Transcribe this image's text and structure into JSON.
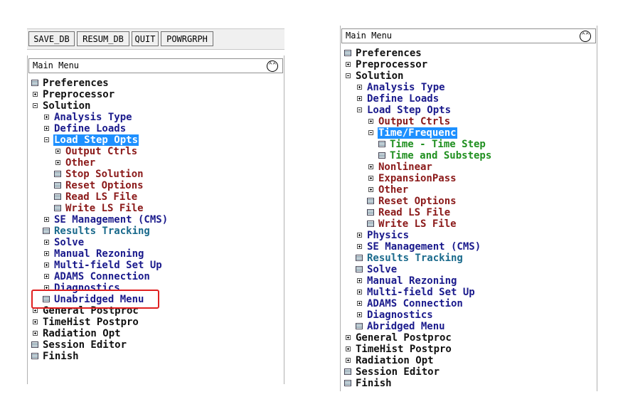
{
  "toolbar": {
    "buttons": [
      {
        "label": "SAVE_DB"
      },
      {
        "label": "RESUM_DB"
      },
      {
        "label": "QUIT"
      },
      {
        "label": "POWRGRPH"
      }
    ]
  },
  "left_panel": {
    "header_title": "Main Menu",
    "collapse_icon": "double-chevron-up-icon",
    "items": [
      {
        "label": "Preferences",
        "level": 0,
        "kind": "leaf",
        "color": "black"
      },
      {
        "label": "Preprocessor",
        "level": 0,
        "kind": "collapsed",
        "color": "black"
      },
      {
        "label": "Solution",
        "level": 0,
        "kind": "expanded",
        "color": "black"
      },
      {
        "label": "Analysis Type",
        "level": 1,
        "kind": "collapsed",
        "color": "navy"
      },
      {
        "label": "Define Loads",
        "level": 1,
        "kind": "collapsed",
        "color": "navy"
      },
      {
        "label": "Load Step Opts",
        "level": 1,
        "kind": "expanded",
        "color": "navy",
        "selected": true
      },
      {
        "label": "Output Ctrls",
        "level": 2,
        "kind": "collapsed",
        "color": "red"
      },
      {
        "label": "Other",
        "level": 2,
        "kind": "collapsed",
        "color": "red"
      },
      {
        "label": "Stop Solution",
        "level": 2,
        "kind": "leaf",
        "color": "red"
      },
      {
        "label": "Reset Options",
        "level": 2,
        "kind": "leaf",
        "color": "red"
      },
      {
        "label": "Read LS File",
        "level": 2,
        "kind": "leaf",
        "color": "red"
      },
      {
        "label": "Write LS File",
        "level": 2,
        "kind": "leaf",
        "color": "red"
      },
      {
        "label": "SE Management (CMS)",
        "level": 1,
        "kind": "collapsed",
        "color": "navy"
      },
      {
        "label": "Results Tracking",
        "level": 1,
        "kind": "leaf",
        "color": "teal"
      },
      {
        "label": "Solve",
        "level": 1,
        "kind": "collapsed",
        "color": "navy"
      },
      {
        "label": "Manual Rezoning",
        "level": 1,
        "kind": "collapsed",
        "color": "navy"
      },
      {
        "label": "Multi-field Set Up",
        "level": 1,
        "kind": "collapsed",
        "color": "navy"
      },
      {
        "label": "ADAMS Connection",
        "level": 1,
        "kind": "collapsed",
        "color": "navy"
      },
      {
        "label": "Diagnostics",
        "level": 1,
        "kind": "collapsed",
        "color": "navy"
      },
      {
        "label": "Unabridged Menu",
        "level": 1,
        "kind": "leaf",
        "color": "navy"
      },
      {
        "label": "General Postproc",
        "level": 0,
        "kind": "collapsed",
        "color": "black"
      },
      {
        "label": "TimeHist Postpro",
        "level": 0,
        "kind": "collapsed",
        "color": "black"
      },
      {
        "label": "Radiation Opt",
        "level": 0,
        "kind": "collapsed",
        "color": "black"
      },
      {
        "label": "Session Editor",
        "level": 0,
        "kind": "leaf",
        "color": "black"
      },
      {
        "label": "Finish",
        "level": 0,
        "kind": "leaf",
        "color": "black"
      }
    ]
  },
  "right_panel": {
    "header_title": "Main Menu",
    "collapse_icon": "double-chevron-up-icon",
    "items": [
      {
        "label": "Preferences",
        "level": 0,
        "kind": "leaf",
        "color": "black"
      },
      {
        "label": "Preprocessor",
        "level": 0,
        "kind": "collapsed",
        "color": "black"
      },
      {
        "label": "Solution",
        "level": 0,
        "kind": "expanded",
        "color": "black"
      },
      {
        "label": "Analysis Type",
        "level": 1,
        "kind": "collapsed",
        "color": "navy"
      },
      {
        "label": "Define Loads",
        "level": 1,
        "kind": "collapsed",
        "color": "navy"
      },
      {
        "label": "Load Step Opts",
        "level": 1,
        "kind": "expanded",
        "color": "navy"
      },
      {
        "label": "Output Ctrls",
        "level": 2,
        "kind": "collapsed",
        "color": "red"
      },
      {
        "label": "Time/Frequenc",
        "level": 2,
        "kind": "expanded",
        "color": "red",
        "selected": true
      },
      {
        "label": "Time - Time Step",
        "level": 3,
        "kind": "leaf",
        "color": "green"
      },
      {
        "label": "Time and Substeps",
        "level": 3,
        "kind": "leaf",
        "color": "green"
      },
      {
        "label": "Nonlinear",
        "level": 2,
        "kind": "collapsed",
        "color": "red"
      },
      {
        "label": "ExpansionPass",
        "level": 2,
        "kind": "collapsed",
        "color": "red"
      },
      {
        "label": "Other",
        "level": 2,
        "kind": "collapsed",
        "color": "red"
      },
      {
        "label": "Reset Options",
        "level": 2,
        "kind": "leaf",
        "color": "red"
      },
      {
        "label": "Read LS File",
        "level": 2,
        "kind": "leaf",
        "color": "red"
      },
      {
        "label": "Write LS File",
        "level": 2,
        "kind": "leaf",
        "color": "red"
      },
      {
        "label": "Physics",
        "level": 1,
        "kind": "collapsed",
        "color": "navy"
      },
      {
        "label": "SE Management (CMS)",
        "level": 1,
        "kind": "collapsed",
        "color": "navy"
      },
      {
        "label": "Results Tracking",
        "level": 1,
        "kind": "leaf",
        "color": "teal"
      },
      {
        "label": "Solve",
        "level": 1,
        "kind": "leaf",
        "color": "navy"
      },
      {
        "label": "Manual Rezoning",
        "level": 1,
        "kind": "collapsed",
        "color": "navy"
      },
      {
        "label": "Multi-field Set Up",
        "level": 1,
        "kind": "collapsed",
        "color": "navy"
      },
      {
        "label": "ADAMS Connection",
        "level": 1,
        "kind": "collapsed",
        "color": "navy"
      },
      {
        "label": "Diagnostics",
        "level": 1,
        "kind": "collapsed",
        "color": "navy"
      },
      {
        "label": "Abridged Menu",
        "level": 1,
        "kind": "leaf",
        "color": "navy"
      },
      {
        "label": "General Postproc",
        "level": 0,
        "kind": "collapsed",
        "color": "black"
      },
      {
        "label": "TimeHist Postpro",
        "level": 0,
        "kind": "collapsed",
        "color": "black"
      },
      {
        "label": "Radiation Opt",
        "level": 0,
        "kind": "collapsed",
        "color": "black"
      },
      {
        "label": "Session Editor",
        "level": 0,
        "kind": "leaf",
        "color": "black"
      },
      {
        "label": "Finish",
        "level": 0,
        "kind": "leaf",
        "color": "black"
      }
    ]
  },
  "colors": {
    "black": "#111111",
    "navy": "#1a1a8c",
    "red": "#8b1a1a",
    "green": "#1f8f1f",
    "teal": "#1a6a8c",
    "selection": "#1e90ff",
    "highlight_box": "#e02020"
  }
}
